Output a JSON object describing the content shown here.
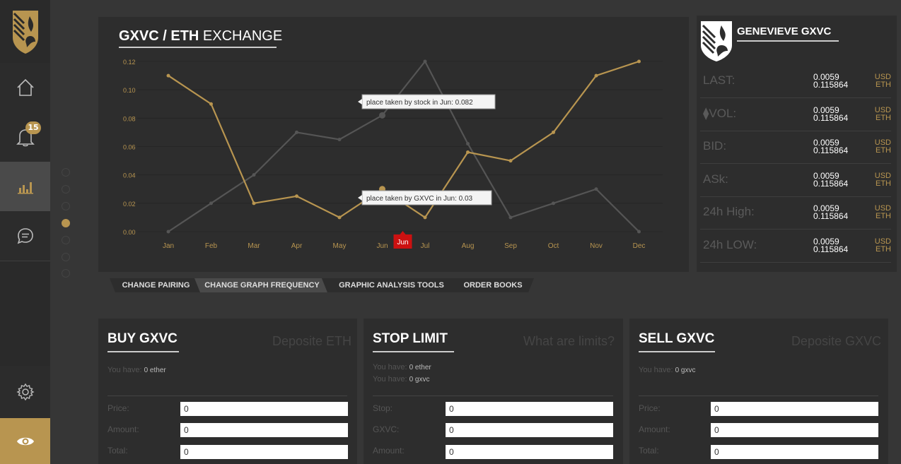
{
  "nav": {
    "notifications_count": "15"
  },
  "chart": {
    "title_bold": "GXVC / ETH",
    "title_rest": " EXCHANGE",
    "tooltip_stock": "place taken by stock in Jun: 0.082",
    "tooltip_gxvc": "place taken by GXVC in Jun: 0.03",
    "hover_label": "Jun"
  },
  "chart_data": {
    "type": "line",
    "categories": [
      "Jan",
      "Feb",
      "Mar",
      "Apr",
      "May",
      "Jun",
      "Jul",
      "Aug",
      "Sep",
      "Oct",
      "Nov",
      "Dec"
    ],
    "series": [
      {
        "name": "GXVC",
        "color": "#b89550",
        "values": [
          0.11,
          0.09,
          0.02,
          0.025,
          0.01,
          0.03,
          0.01,
          0.056,
          0.05,
          0.07,
          0.11,
          0.12
        ]
      },
      {
        "name": "stock",
        "color": "#555555",
        "values": [
          0.0,
          0.02,
          0.04,
          0.07,
          0.065,
          0.082,
          0.12,
          0.062,
          0.01,
          0.02,
          0.03,
          0.0
        ]
      }
    ],
    "yticks": [
      "0.12",
      "0.10",
      "0.08",
      "0.06",
      "0.04",
      "0.02",
      "0.00"
    ],
    "ylim": [
      0,
      0.12
    ],
    "grid": true
  },
  "stats": {
    "title": "GENEVIEVE GXVC",
    "rows": [
      {
        "label": "LAST:",
        "usd": "0.0059",
        "eth": "0.115864",
        "unit1": "USD",
        "unit2": "ETH"
      },
      {
        "label": "⧫VOL:",
        "usd": "0.0059",
        "eth": "0.115864",
        "unit1": "USD",
        "unit2": "ETH"
      },
      {
        "label": "BID:",
        "usd": "0.0059",
        "eth": "0.115864",
        "unit1": "USD",
        "unit2": "ETH"
      },
      {
        "label": "ASk:",
        "usd": "0.0059",
        "eth": "0.115864",
        "unit1": "USD",
        "unit2": "ETH"
      },
      {
        "label": "24h High:",
        "usd": "0.0059",
        "eth": "0.115864",
        "unit1": "USD",
        "unit2": "ETH"
      },
      {
        "label": "24h LOW:",
        "usd": "0.0059",
        "eth": "0.115864",
        "unit1": "USD",
        "unit2": "ETH"
      }
    ]
  },
  "tabs": [
    "CHANGE PAIRING",
    "CHANGE GRAPH FREQUENCY",
    "GRAPHIC ANALYSIS TOOLS",
    "ORDER BOOKS"
  ],
  "buy": {
    "title": "BUY GXVC",
    "link": "Deposite ETH",
    "have1_label": "You have:",
    "have1_value": "0 ether",
    "price_label": "Price:",
    "price_value": "0",
    "amount_label": "Amount:",
    "amount_value": "0",
    "total_label": "Total:",
    "total_value": "0"
  },
  "stop": {
    "title": "STOP LIMIT",
    "link": "What are limits?",
    "have1_label": "You have:",
    "have1_value": "0 ether",
    "have2_label": "You have:",
    "have2_value": "0 gxvc",
    "stop_label": "Stop:",
    "stop_value": "0",
    "gxvc_label": "GXVC:",
    "gxvc_value": "0",
    "amount_label": "Amount:",
    "amount_value": "0"
  },
  "sell": {
    "title": "SELL GXVC",
    "link": "Deposite GXVC",
    "have1_label": "You have:",
    "have1_value": "0 gxvc",
    "price_label": "Price:",
    "price_value": "0",
    "amount_label": "Amount:",
    "amount_value": "0",
    "total_label": "Total:",
    "total_value": "0"
  }
}
